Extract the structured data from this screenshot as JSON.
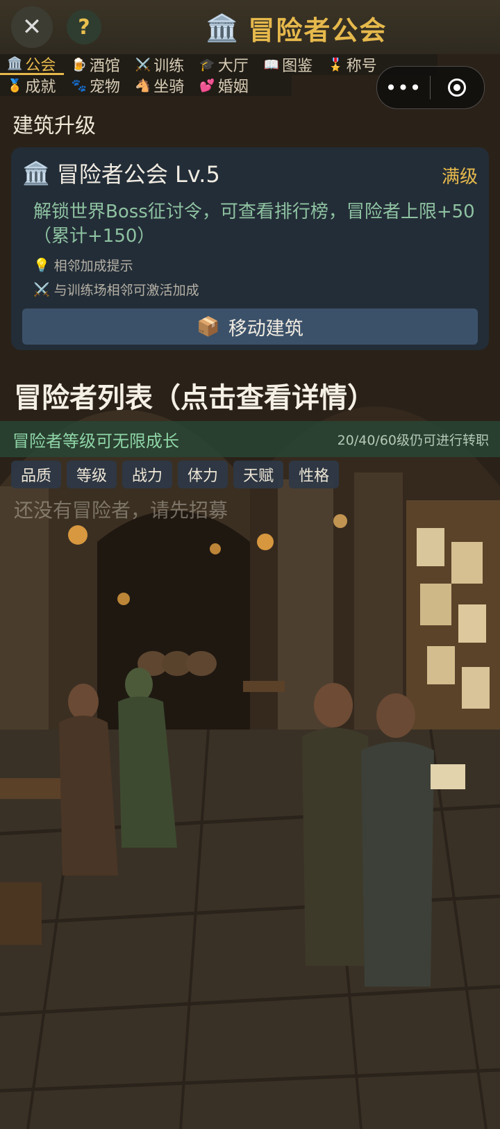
{
  "header": {
    "title": "冒险者公会",
    "title_icon": "🏛️",
    "close_glyph": "✕",
    "help_glyph": "?"
  },
  "tabs": {
    "row1": [
      {
        "icon": "🏛️",
        "label": "公会",
        "active": true
      },
      {
        "icon": "🍺",
        "label": "酒馆"
      },
      {
        "icon": "⚔️",
        "label": "训练"
      },
      {
        "icon": "🎓",
        "label": "大厅"
      },
      {
        "icon": "📖",
        "label": "图鉴"
      },
      {
        "icon": "🎖️",
        "label": "称号"
      }
    ],
    "row2": [
      {
        "icon": "🏅",
        "label": "成就"
      },
      {
        "icon": "🐾",
        "label": "宠物"
      },
      {
        "icon": "🐴",
        "label": "坐骑"
      },
      {
        "icon": "💕",
        "label": "婚姻"
      }
    ]
  },
  "capsule": {
    "more_glyph": "•••"
  },
  "building": {
    "section_label": "建筑升级",
    "icon": "🏛️",
    "name": "冒险者公会 Lv.5",
    "status": "满级",
    "description": "解锁世界Boss征讨令，可查看排行榜，冒险者上限+50（累计+150）",
    "hint1_icon": "💡",
    "hint1": "相邻加成提示",
    "hint2_icon": "⚔️",
    "hint2": "与训练场相邻可激活加成",
    "move_icon": "📦",
    "move_label": "移动建筑"
  },
  "adventurers": {
    "heading": "冒险者列表（点击查看详情）",
    "growth_left": "冒险者等级可无限成长",
    "growth_right": "20/40/60级仍可进行转职",
    "filters": [
      "品质",
      "等级",
      "战力",
      "体力",
      "天赋",
      "性格"
    ],
    "empty_text": "还没有冒险者，请先招募"
  }
}
